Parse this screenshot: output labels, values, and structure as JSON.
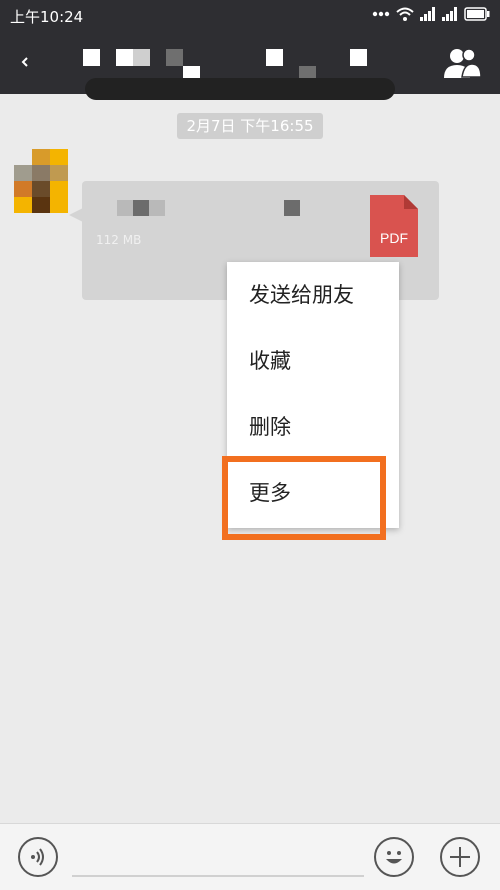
{
  "status_bar": {
    "time": "上午10:24",
    "icons": [
      "more-dots-icon",
      "wifi-icon",
      "signal-icon",
      "signal-icon",
      "battery-icon"
    ]
  },
  "title_bar": {
    "back_icon": "chevron-left-icon",
    "right_icon": "contacts-icon"
  },
  "chat": {
    "timestamp": "2月7日 下午16:55",
    "file_message": {
      "size_text": "112 MB",
      "file_type": "PDF",
      "pdf_color": "#d9534f"
    }
  },
  "context_menu": {
    "items": [
      {
        "label": "发送给朋友"
      },
      {
        "label": "收藏"
      },
      {
        "label": "删除"
      },
      {
        "label": "更多"
      }
    ],
    "highlight_color": "#f26f1f"
  },
  "input_bar": {
    "left_icon": "voice-icon",
    "emoji_icon": "emoji-icon",
    "plus_icon": "plus-icon"
  }
}
